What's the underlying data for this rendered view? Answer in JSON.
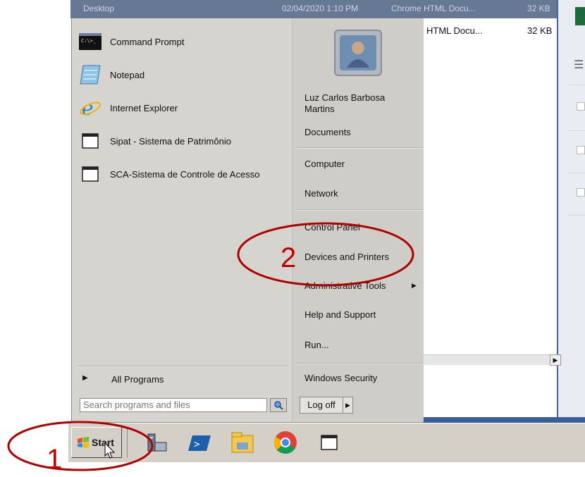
{
  "background_window": {
    "top_row": {
      "name": "Desktop",
      "date": "02/04/2020 1:10 PM",
      "type": "Chrome HTML Docu...",
      "size": "32 KB"
    },
    "file_row": {
      "type": "HTML Docu...",
      "size": "32 KB"
    }
  },
  "start_menu": {
    "programs": [
      {
        "label": "Command Prompt",
        "icon": "command-prompt-icon"
      },
      {
        "label": "Notepad",
        "icon": "notepad-icon"
      },
      {
        "label": "Internet Explorer",
        "icon": "internet-explorer-icon"
      },
      {
        "label": "Sipat - Sistema de Patrimônio",
        "icon": "window-icon"
      },
      {
        "label": "SCA-Sistema de Controle de Acesso",
        "icon": "window-icon"
      }
    ],
    "all_programs": "All Programs",
    "search_placeholder": "Search programs and files",
    "user_name_line1": "Luz Carlos Barbosa",
    "user_name_line2": "Martins",
    "right_items": [
      "Documents",
      "Computer",
      "Network",
      "Control Panel",
      "Devices and Printers",
      "Administrative Tools",
      "Help and Support",
      "Run...",
      "Windows Security"
    ],
    "log_off": "Log off"
  },
  "taskbar": {
    "start_label": "Start",
    "icons": [
      "server-manager-icon",
      "powershell-icon",
      "file-explorer-icon",
      "chrome-icon",
      "window-icon"
    ]
  },
  "annotations": {
    "one": "1",
    "two": "2",
    "color": "#c00000"
  }
}
